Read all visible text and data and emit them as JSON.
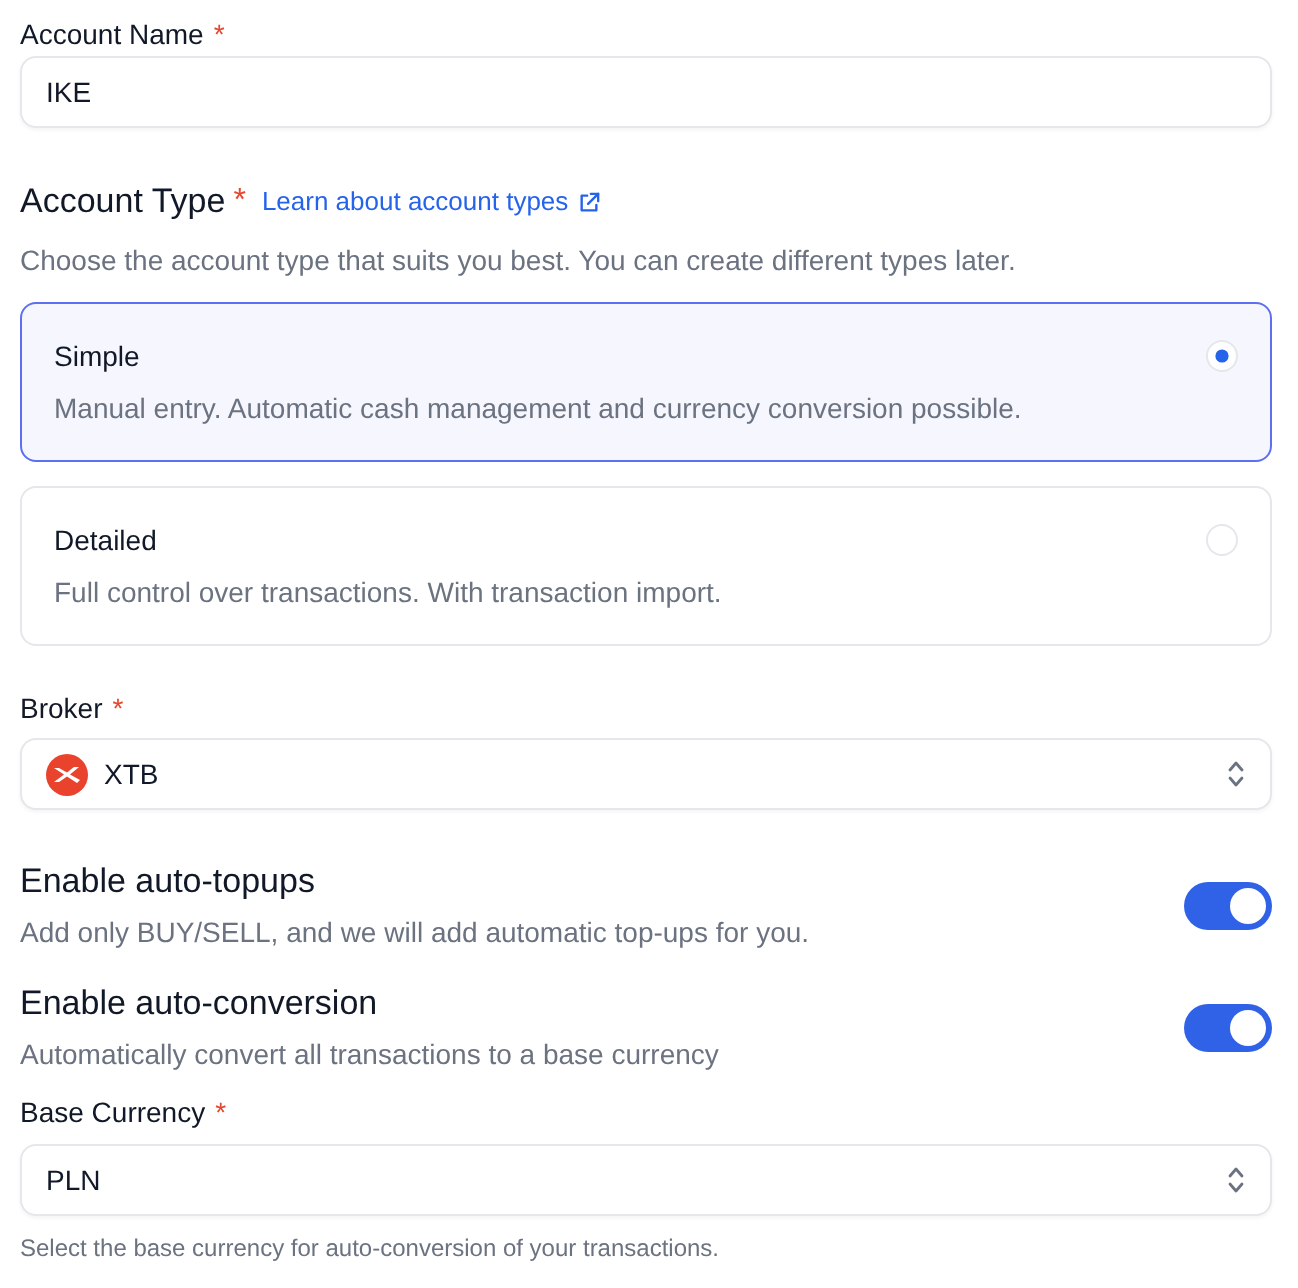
{
  "account_name": {
    "label": "Account Name",
    "required_mark": "*",
    "value": "IKE"
  },
  "account_type": {
    "label": "Account Type",
    "required_mark": "*",
    "link": "Learn about account types",
    "description": "Choose the account type that suits you best. You can create different types later.",
    "options": [
      {
        "title": "Simple",
        "description": "Manual entry. Automatic cash management and currency conversion possible.",
        "selected": true
      },
      {
        "title": "Detailed",
        "description": "Full control over transactions. With transaction import.",
        "selected": false
      }
    ]
  },
  "broker": {
    "label": "Broker",
    "required_mark": "*",
    "value": "XTB"
  },
  "toggles": [
    {
      "label": "Enable auto-topups",
      "description": "Add only BUY/SELL, and we will add automatic top-ups for you.",
      "on": true
    },
    {
      "label": "Enable auto-conversion",
      "description": "Automatically convert all transactions to a base currency",
      "on": true
    }
  ],
  "base_currency": {
    "label": "Base Currency",
    "required_mark": "*",
    "value": "PLN",
    "help": "Select the base currency for auto-conversion of your transactions."
  }
}
